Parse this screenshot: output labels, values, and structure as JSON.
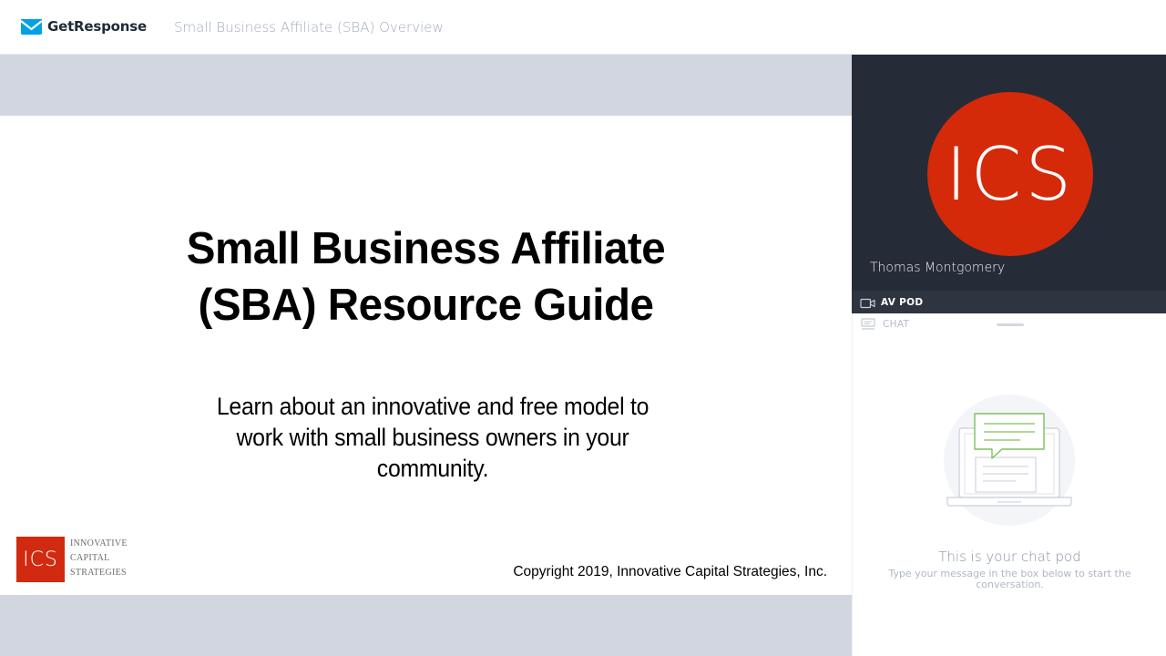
{
  "header": {
    "brand_name": "GetResponse",
    "webinar_title": "Small Business Affiliate (SBA) Overview"
  },
  "slide": {
    "title_line1": "Small Business Affiliate",
    "title_line2": "(SBA) Resource Guide",
    "subtitle_line1": "Learn about an innovative and free model to",
    "subtitle_line2": "work with small business owners in your",
    "subtitle_line3": "community.",
    "logo_mark": "ICS",
    "logo_word1": "INNOVATIVE",
    "logo_word2": "CAPITAL",
    "logo_word3": "STRATEGIES",
    "copyright": "Copyright 2019, Innovative Capital Strategies, Inc."
  },
  "av_pod": {
    "avatar_text": "ICS",
    "presenter_name": "Thomas Montgomery",
    "pod_label": "AV POD"
  },
  "chat_pod": {
    "label": "CHAT",
    "empty_title": "This is your chat pod",
    "empty_hint": "Type your message in the box below to start the conversation."
  },
  "colors": {
    "brand_blue": "#00a2e5",
    "ics_red": "#d42a0a",
    "av_background": "#262c37",
    "stage_gray": "#d2d6e0",
    "chat_green": "#7dc15b"
  },
  "icons": {
    "brand": "envelope-icon",
    "av_pod": "video-camera-icon",
    "chat": "chat-icon"
  }
}
